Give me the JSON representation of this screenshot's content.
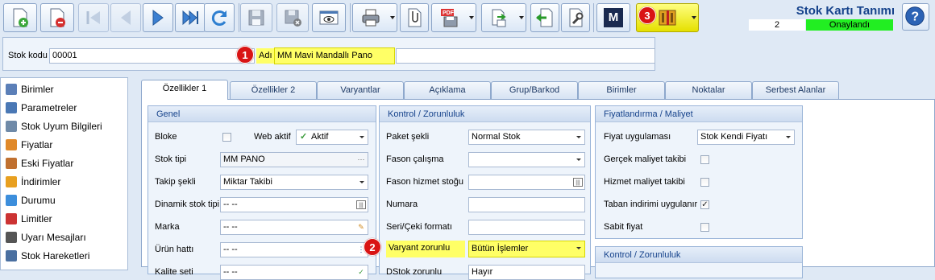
{
  "header": {
    "title": "Stok Kartı Tanımı",
    "record_number": "2",
    "status": "Onaylandı",
    "status_color": "#22ee22",
    "marker3": "3"
  },
  "toolbar": {
    "buttons": [
      "add-icon",
      "delete-icon",
      "first-icon",
      "prev-icon",
      "next-icon",
      "last-icon",
      "refresh-icon",
      "save-icon",
      "discard-icon",
      "preview-icon",
      "print-icon",
      "attach-icon",
      "pdf-export-icon",
      "export-icon",
      "back-icon",
      "tools-icon",
      "m-logo-icon",
      "barcode-icon",
      "help-icon"
    ],
    "m_label": "M"
  },
  "stock_header": {
    "code_label": "Stok kodu",
    "code_value": "00001",
    "marker1": "1",
    "name_label": "Adı",
    "name_value": "MM Mavi Mandallı Pano"
  },
  "sidebar": {
    "items": [
      {
        "label": "Birimler",
        "icon": "units-icon",
        "color": "#5b7fb8"
      },
      {
        "label": "Parametreler",
        "icon": "parameters-icon",
        "color": "#4a78b5"
      },
      {
        "label": "Stok Uyum Bilgileri",
        "icon": "compatibility-icon",
        "color": "#6f8aa8"
      },
      {
        "label": "Fiyatlar",
        "icon": "prices-icon",
        "color": "#e0892a"
      },
      {
        "label": "Eski Fiyatlar",
        "icon": "old-prices-icon",
        "color": "#c07030"
      },
      {
        "label": "İndirimler",
        "icon": "discounts-icon",
        "color": "#e8a020"
      },
      {
        "label": "Durumu",
        "icon": "status-icon",
        "color": "#3c8edc"
      },
      {
        "label": "Limitler",
        "icon": "limits-icon",
        "color": "#cc3333"
      },
      {
        "label": "Uyarı Mesajları",
        "icon": "warnings-icon",
        "color": "#555555"
      },
      {
        "label": "Stok Hareketleri",
        "icon": "movements-icon",
        "color": "#4a6fa0"
      }
    ]
  },
  "tabs": [
    "Özellikler 1",
    "Özellikler 2",
    "Varyantlar",
    "Açıklama",
    "Grup/Barkod",
    "Birimler",
    "Noktalar",
    "Serbest Alanlar"
  ],
  "genel": {
    "title": "Genel",
    "bloke_label": "Bloke",
    "web_label": "Web aktif",
    "web_value": "Aktif",
    "stok_tipi_label": "Stok tipi",
    "stok_tipi_value": "MM PANO",
    "takip_label": "Takip şekli",
    "takip_value": "Miktar Takibi",
    "dinamik_label": "Dinamik stok tipi",
    "dinamik_value": "-- --",
    "marka_label": "Marka",
    "marka_value": "-- --",
    "urun_label": "Ürün hattı",
    "urun_value": "-- --",
    "kalite_label": "Kalite seti",
    "kalite_value": "-- --"
  },
  "kontrol": {
    "title": "Kontrol / Zorunluluk",
    "paket_label": "Paket şekli",
    "paket_value": "Normal Stok",
    "fason_label": "Fason çalışma",
    "fason_value": "",
    "fason_hizmet_label": "Fason hizmet stoğu",
    "fason_hizmet_value": "",
    "numara_label": "Numara",
    "numara_value": "",
    "seri_label": "Seri/Çeki formatı",
    "seri_value": "",
    "marker2": "2",
    "varyant_label": "Varyant zorunlu",
    "varyant_value": "Bütün İşlemler",
    "dstok_label": "DStok zorunlu",
    "dstok_value": "Hayır"
  },
  "fiyat": {
    "title": "Fiyatlandırma / Maliyet",
    "uygulama_label": "Fiyat uygulaması",
    "uygulama_value": "Stok Kendi Fiyatı",
    "gercek_label": "Gerçek maliyet takibi",
    "gercek_checked": false,
    "hizmet_label": "Hizmet maliyet takibi",
    "hizmet_checked": false,
    "taban_label": "Taban indirimi uygulanır",
    "taban_checked": true,
    "sabit_label": "Sabit fiyat",
    "sabit_checked": false
  },
  "kontrol2": {
    "title": "Kontrol / Zorunluluk"
  }
}
